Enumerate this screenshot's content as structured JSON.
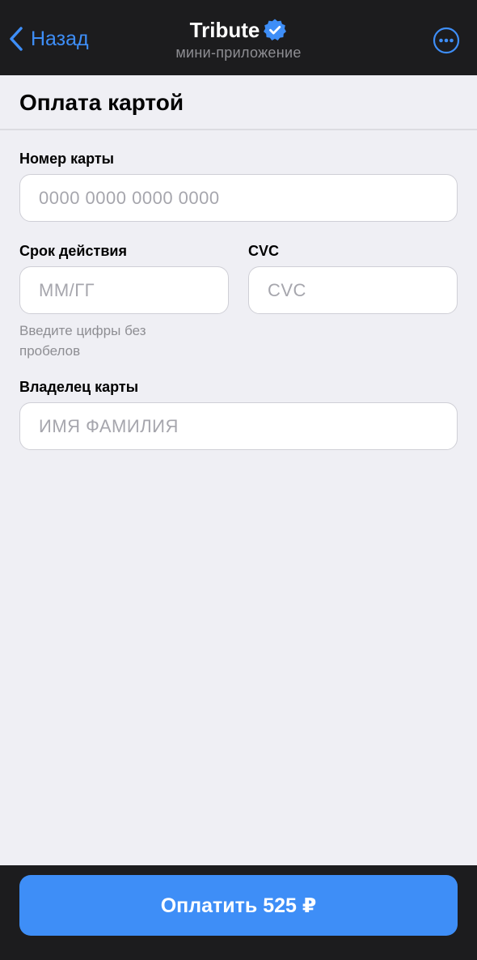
{
  "colors": {
    "accent": "#3e8ef7",
    "top_bar_background": "#1c1c1e",
    "page_background": "#efeff4"
  },
  "topbar": {
    "back_label": "Назад",
    "back_icon": "chevron-left-icon",
    "title": "Tributе",
    "verified_icon": "verified-badge-icon",
    "subtitle": "мини-приложение",
    "more_icon": "more-icon"
  },
  "page": {
    "title": "Оплата картой"
  },
  "form": {
    "card_number": {
      "label": "Номер карты",
      "value": "",
      "placeholder": "0000 0000 0000 0000"
    },
    "expiry": {
      "label": "Срок действия",
      "value": "",
      "placeholder": "ММ/ГГ",
      "hint": "Введите цифры без пробелов"
    },
    "cvc": {
      "label": "CVC",
      "value": "",
      "placeholder": "CVC"
    },
    "holder": {
      "label": "Владелец карты",
      "value": "",
      "placeholder": "ИМЯ ФАМИЛИЯ"
    }
  },
  "footer": {
    "pay_label": "Оплатить 525 ₽"
  }
}
